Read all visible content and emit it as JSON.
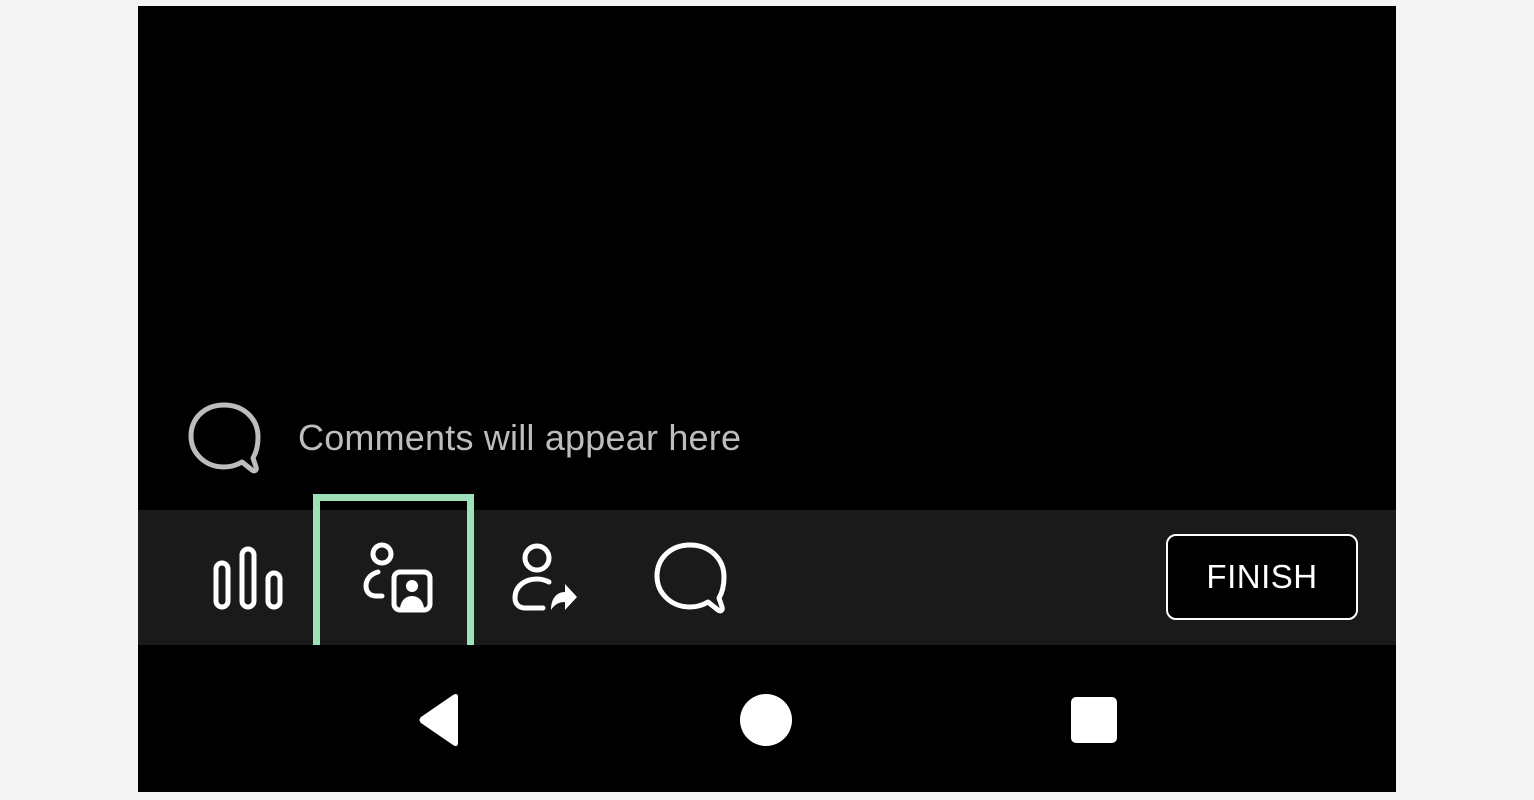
{
  "comments": {
    "placeholder_text": "Comments will appear here",
    "icon": "comment-bubble-icon"
  },
  "toolbar": {
    "items": [
      {
        "name": "stats",
        "icon": "bar-chart-icon"
      },
      {
        "name": "guest",
        "icon": "add-guest-icon",
        "highlighted": true
      },
      {
        "name": "invite",
        "icon": "invite-user-icon"
      },
      {
        "name": "comments",
        "icon": "comment-bubble-icon"
      }
    ],
    "finish_label": "FINISH"
  },
  "navigation": {
    "back_icon": "back-triangle-icon",
    "home_icon": "home-circle-icon",
    "recents_icon": "recents-square-icon"
  },
  "colors": {
    "highlight": "#9ee0b8",
    "toolbar_bg": "#1a1a1a",
    "screen_bg": "#000000",
    "hint_text": "#bdbdbd"
  }
}
